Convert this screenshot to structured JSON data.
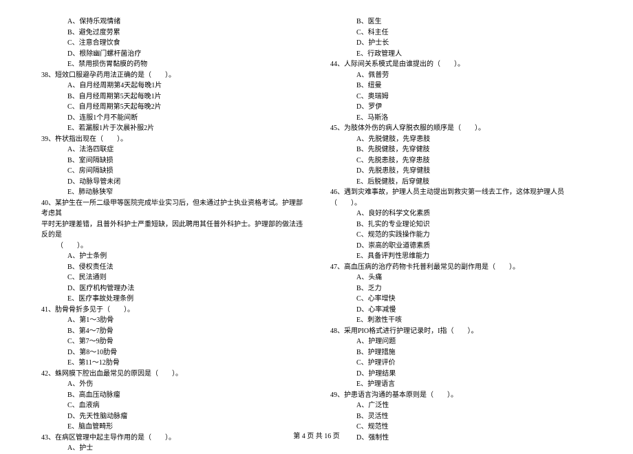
{
  "left": {
    "pre_options": [
      "A、保持乐观情绪",
      "B、避免过度劳累",
      "C、注意合理饮食",
      "D、根除幽门螺杆菌治疗",
      "E、禁用损伤胃黏膜的药物"
    ],
    "q38": "38、短效口服避孕药用法正确的是（　　）。",
    "q38_opts": [
      "A、自月经周期第4天起每晚1片",
      "B、自月经周期第5天起每晚1片",
      "C、自月经周期第5天起每晚2片",
      "D、连服1个月不能间断",
      "E、若漏服1片于次晨补服2片"
    ],
    "q39": "39、杵状指出现在（　　）。",
    "q39_opts": [
      "A、法洛四联症",
      "B、室间隔缺损",
      "C、房间隔缺损",
      "D、动脉导管未闭",
      "E、肺动脉狭窄"
    ],
    "q40_l1": "40、某护生在一所二级甲等医院完成毕业实习后，但未通过护士执业资格考试。护理部考虑其",
    "q40_l2": "平时无护理差错，且普外科护士严重短缺，因此聘用其任普外科护士。护理部的做法违反的是",
    "q40_l3": "（　　）。",
    "q40_opts": [
      "A、护士条例",
      "B、侵权责任法",
      "C、民法通则",
      "D、医疗机构管理办法",
      "E、医疗事故处理条例"
    ],
    "q41": "41、肋骨骨折多见于（　　）。",
    "q41_opts": [
      "A、第1～3肋骨",
      "B、第4～7肋骨",
      "C、第7～9肋骨",
      "D、第8～10肋骨",
      "E、第11～12肋骨"
    ],
    "q42": "42、蛛网膜下腔出血最常见的原因是（　　）。",
    "q42_opts": [
      "A、外伤",
      "B、高血压动脉瘤",
      "C、血液病",
      "D、先天性脑动脉瘤",
      "E、脑血管畸形"
    ],
    "q43": "43、在病区管理中起主导作用的是（　　）。",
    "q43_opts": [
      "A、护士"
    ]
  },
  "right": {
    "pre_options": [
      "B、医生",
      "C、科主任",
      "D、护士长",
      "E、行政管理人"
    ],
    "q44": "44、人际间关系模式是由谁提出的（　　）。",
    "q44_opts": [
      "A、佩普劳",
      "B、纽曼",
      "C、奥瑞姆",
      "D、罗伊",
      "E、马斯洛"
    ],
    "q45": "45、为肢体外伤的病人穿脱衣服的顺序是（　　）。",
    "q45_opts": [
      "A、先脱健肢，先穿患肢",
      "B、先脱健肢，先穿健肢",
      "C、先脱患肢，先穿患肢",
      "D、先脱患肢，先穿健肢",
      "E、后脱健肢，后穿健肢"
    ],
    "q46": "46、遇到灾难事故，护理人员主动提出到救灾第一线去工作，这体现护理人员（　　）。",
    "q46_opts": [
      "A、良好的科学文化素质",
      "B、扎实的专业理论知识",
      "C、规范的实践操作能力",
      "D、崇高的职业道德素质",
      "E、具备评判性思维能力"
    ],
    "q47": "47、高血压病的治疗药物卡托普利最常见的副作用是（　　）。",
    "q47_opts": [
      "A、头痛",
      "B、乏力",
      "C、心率增快",
      "D、心率减慢",
      "E、刺激性干咳"
    ],
    "q48": "48、采用PIO格式进行护理记录时，I指（　　）。",
    "q48_opts": [
      "A、护理问题",
      "B、护理措施",
      "C、护理评价",
      "D、护理结果",
      "E、护理语言"
    ],
    "q49": "49、护患语言沟通的基本原则是（　　）。",
    "q49_opts": [
      "A、广泛性",
      "B、灵活性",
      "C、规范性",
      "D、强制性"
    ]
  },
  "footer": "第 4 页 共 16 页"
}
